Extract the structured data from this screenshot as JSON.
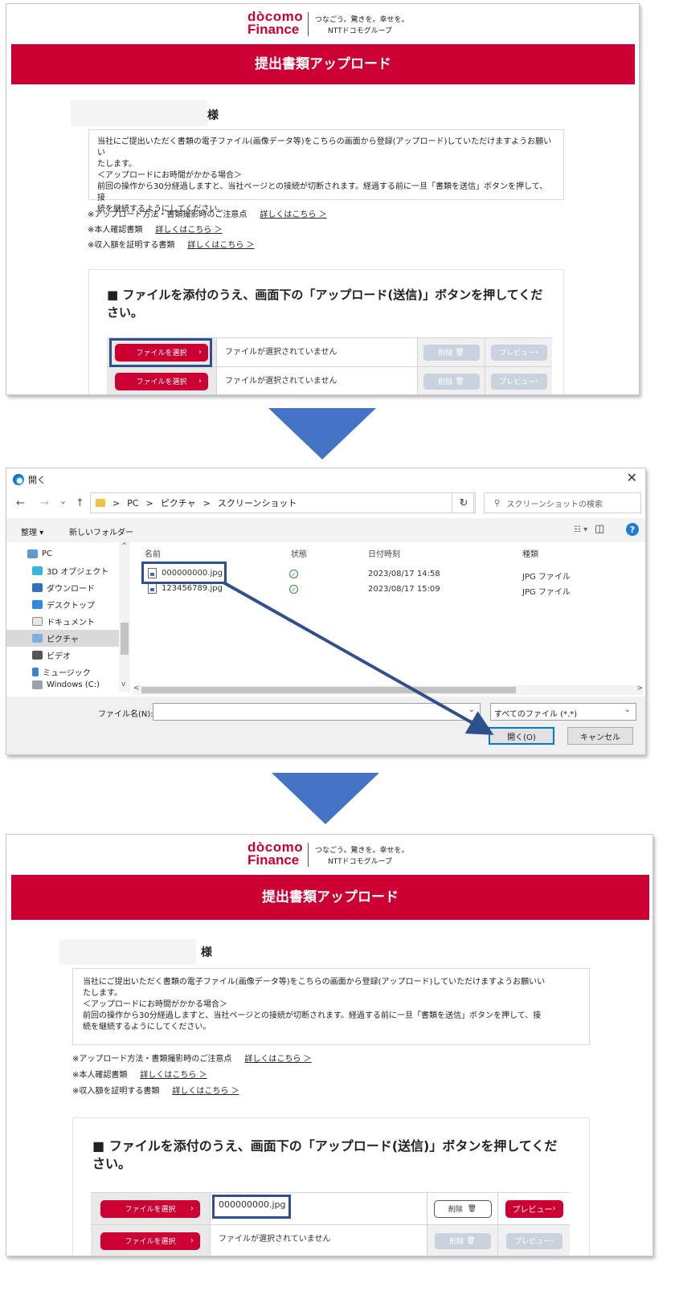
{
  "page": {
    "logo_line1": "dòcomo",
    "logo_line2": "Finance",
    "slogan_line1": "つなごう。驚きを。幸せを。",
    "slogan_line2": "NTTドコモグループ",
    "title": "提出書類アップロード",
    "name_suffix": "様",
    "notice": [
      "当社にご提出いただく書類の電子ファイル(画像データ等)をこちらの画面から登録(アップロード)していただけますようお願いい",
      "たします。",
      "＜アップロードにお時間がかかる場合＞",
      "前回の操作から30分経過しますと、当社ページとの接続が切断されます。経過する前に一旦「書類を送信」ボタンを押して、接",
      "続を継続するようにしてください。"
    ],
    "links": [
      {
        "label": "※アップロード方法・書類撮影時のご注意点",
        "link": "詳しくはこちら ＞"
      },
      {
        "label": "※本人確認書類",
        "link": "詳しくはこちら ＞"
      },
      {
        "label": "※収入額を証明する書類",
        "link": "詳しくはこちら ＞"
      }
    ],
    "instruction_line1": "■ ファイルを添付のうえ、画面下の「アップロード(送信)」ボタンを押してくだ",
    "instruction_line2": "さい。",
    "select_button": "ファイルを選択",
    "no_file": "ファイルが選択されていません",
    "delete_button": "削除",
    "preview_button": "プレビュー",
    "selected_file": "000000000.jpg",
    "arrow_glyph": "›",
    "trash_glyph": "🗑"
  },
  "dialog": {
    "title": "開く",
    "close": "✕",
    "nav_back": "←",
    "nav_fwd": "→",
    "nav_down": "⌄",
    "nav_up": "↑",
    "breadcrumb": [
      "PC",
      "ピクチャ",
      "スクリーンショット"
    ],
    "sep": ">",
    "addr_dropdown": "⌄",
    "refresh": "↻",
    "search_glyph": "⚲",
    "search_placeholder": "スクリーンショットの検索",
    "organize": "整理 ▾",
    "new_folder": "新しいフォルダー",
    "view_glyph": "☷ ▾",
    "pane_glyph": "◫",
    "help": "?",
    "tree": [
      "PC",
      "3D オブジェクト",
      "ダウンロード",
      "デスクトップ",
      "ドキュメント",
      "ピクチャ",
      "ビデオ",
      "ミュージック",
      "Windows (C:)"
    ],
    "columns": {
      "name": "名前",
      "status": "状態",
      "date": "日付時刻",
      "type": "種類"
    },
    "files": [
      {
        "name": "000000000.jpg",
        "status": "✓",
        "date": "2023/08/17 14:58",
        "type": "JPG ファイル"
      },
      {
        "name": "123456789.jpg",
        "status": "✓",
        "date": "2023/08/17 15:09",
        "type": "JPG ファイル"
      }
    ],
    "filename_label": "ファイル名(N):",
    "filter": "すべてのファイル (*.*)",
    "open_button": "開く(O)",
    "cancel_button": "キャンセル",
    "scroll_left": "<",
    "scroll_right": ">",
    "scroll_up": "^",
    "scroll_down": "v"
  },
  "colors": {
    "brand": "#cc0033",
    "arrow": "#4472c4",
    "highlight": "#2f4f8f",
    "accent": "#0078d7"
  }
}
